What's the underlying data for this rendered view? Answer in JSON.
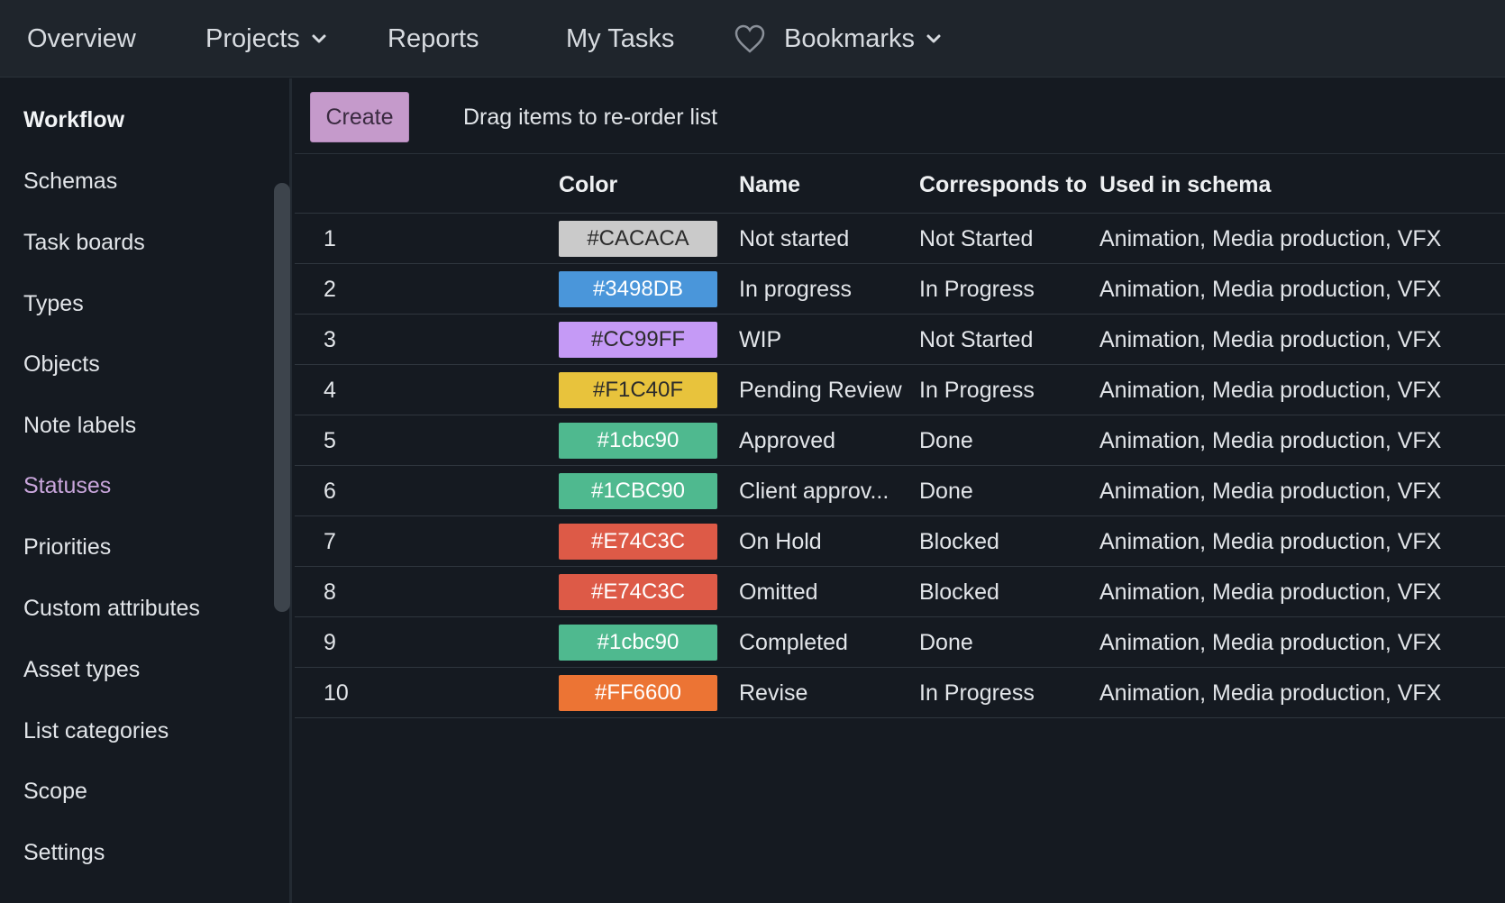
{
  "topnav": {
    "items": [
      {
        "label": "Overview"
      },
      {
        "label": "Projects"
      },
      {
        "label": "Reports"
      },
      {
        "label": "My Tasks"
      },
      {
        "label": "Bookmarks"
      }
    ],
    "icons": {
      "dropdown": "chevron-down-icon",
      "bookmarks": "heart-icon"
    }
  },
  "sidebar": {
    "items": [
      {
        "label": "Workflow"
      },
      {
        "label": "Schemas"
      },
      {
        "label": "Task boards"
      },
      {
        "label": "Types"
      },
      {
        "label": "Objects"
      },
      {
        "label": "Note labels"
      },
      {
        "label": "Statuses"
      },
      {
        "label": "Priorities"
      },
      {
        "label": "Custom attributes"
      },
      {
        "label": "Asset types"
      },
      {
        "label": "List categories"
      },
      {
        "label": "Scope"
      },
      {
        "label": "Settings"
      }
    ],
    "active_label": "Statuses",
    "active_color": "#c9a6dc"
  },
  "toolbar": {
    "create_label": "Create",
    "create_color": "#c59acb",
    "hint": "Drag items to re-order list"
  },
  "table": {
    "columns": [
      "",
      "Color",
      "Name",
      "Corresponds to",
      "Used in schema"
    ],
    "rows": [
      {
        "index": "1",
        "color": "#CACACA",
        "bg": "#cacaca",
        "fg": "#2b2b2b",
        "name": "Not started",
        "corresponds": "Not Started",
        "schema": "Animation, Media production, VFX"
      },
      {
        "index": "2",
        "color": "#3498DB",
        "bg": "#4a96da",
        "fg": "#ffffff",
        "name": "In progress",
        "corresponds": "In Progress",
        "schema": "Animation, Media production, VFX"
      },
      {
        "index": "3",
        "color": "#CC99FF",
        "bg": "#c59af6",
        "fg": "#2b2b2b",
        "name": "WIP",
        "corresponds": "Not Started",
        "schema": "Animation, Media production, VFX"
      },
      {
        "index": "4",
        "color": "#F1C40F",
        "bg": "#e8c33c",
        "fg": "#2b2b2b",
        "name": "Pending Review",
        "corresponds": "In Progress",
        "schema": "Animation, Media production, VFX"
      },
      {
        "index": "5",
        "color": "#1cbc90",
        "bg": "#4fb98f",
        "fg": "#ffffff",
        "name": "Approved",
        "corresponds": "Done",
        "schema": "Animation, Media production, VFX"
      },
      {
        "index": "6",
        "color": "#1CBC90",
        "bg": "#4fb98f",
        "fg": "#ffffff",
        "name": "Client approv...",
        "corresponds": "Done",
        "schema": "Animation, Media production, VFX"
      },
      {
        "index": "7",
        "color": "#E74C3C",
        "bg": "#dd5a47",
        "fg": "#ffffff",
        "name": "On Hold",
        "corresponds": "Blocked",
        "schema": "Animation, Media production, VFX"
      },
      {
        "index": "8",
        "color": "#E74C3C",
        "bg": "#dd5a47",
        "fg": "#ffffff",
        "name": "Omitted",
        "corresponds": "Blocked",
        "schema": "Animation, Media production, VFX"
      },
      {
        "index": "9",
        "color": "#1cbc90",
        "bg": "#4fb98f",
        "fg": "#ffffff",
        "name": "Completed",
        "corresponds": "Done",
        "schema": "Animation, Media production, VFX"
      },
      {
        "index": "10",
        "color": "#FF6600",
        "bg": "#ec7434",
        "fg": "#ffffff",
        "name": "Revise",
        "corresponds": "In Progress",
        "schema": "Animation, Media production, VFX"
      }
    ]
  }
}
